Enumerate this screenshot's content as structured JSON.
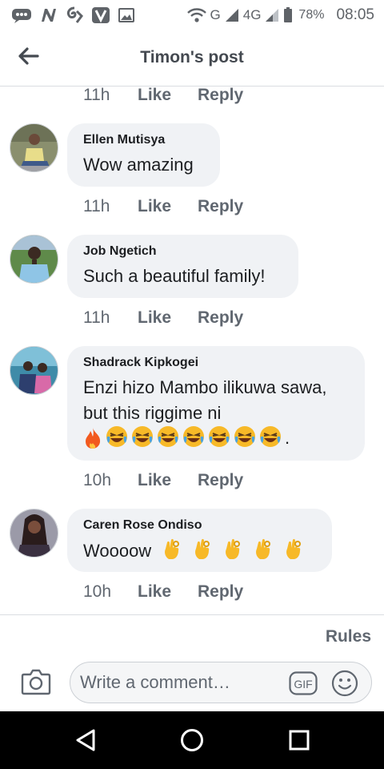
{
  "status_bar": {
    "network_labels": [
      "G",
      "4G"
    ],
    "battery": "78%",
    "time": "08:05"
  },
  "header": {
    "title": "Timon's post"
  },
  "actions": {
    "like": "Like",
    "reply": "Reply"
  },
  "top_meta": {
    "time": "11h"
  },
  "comments": [
    {
      "author": "Ellen Mutisya",
      "text": "Wow amazing",
      "time": "11h"
    },
    {
      "author": "Job Ngetich",
      "text": "Such a beautiful family!",
      "time": "11h"
    },
    {
      "author": "Shadrack Kipkogei",
      "text_line1": "Enzi hizo Mambo ilikuwa sawa,",
      "text_line2": "but this riggime ni",
      "emoji_suffix": ".",
      "time": "10h"
    },
    {
      "author": "Caren Rose Ondiso",
      "text": "Woooow",
      "time": "10h"
    }
  ],
  "footer": {
    "rules": "Rules",
    "placeholder": "Write a comment…",
    "gif_label": "GIF"
  },
  "colors": {
    "bubble": "#f0f2f5",
    "meta_text": "#606770",
    "divider": "#dadde1"
  }
}
